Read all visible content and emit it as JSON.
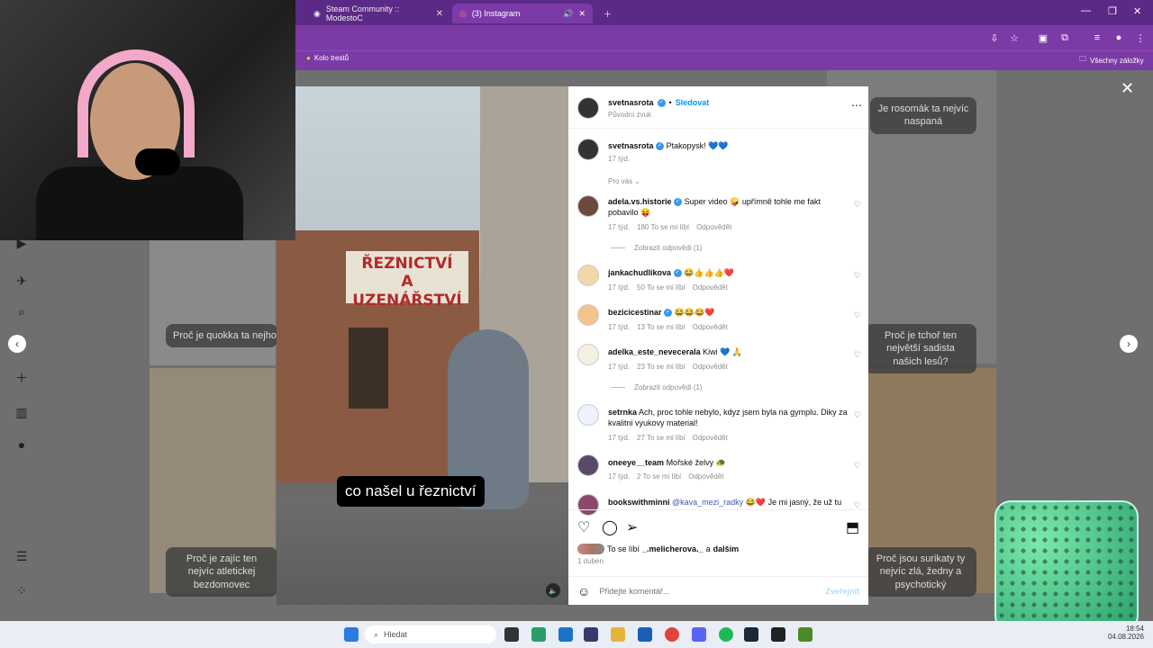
{
  "browser": {
    "tabs": [
      {
        "title": "Steam Community :: ModestoC",
        "active": false
      },
      {
        "title": "(3) Instagram",
        "active": true
      }
    ],
    "bookmarks": {
      "left_item": "Kolo trestů",
      "right_item": "Všechny záložky"
    }
  },
  "page": {
    "captions": {
      "top_right": "Je rosomák ta nejvíc naspaná",
      "left_mid": "Proč je quokka ta nejhorší psychopatická",
      "right_mid": "Proč je tchoř ten největší sadista našich lesů?",
      "left_bottom": "Proč je zajíc ten nejvíc atletickej bezdomovec",
      "right_bottom": "Proč jsou surikaty ty nejvíc zlá, žedny a psychotický"
    }
  },
  "video": {
    "subtitle": "co našel u řeznictví",
    "sign_line1": "ŘEZNICTVÍ",
    "sign_line2": "A UZENÁŘSTVÍ"
  },
  "post": {
    "author": "svetnasrota",
    "follow_label": "Sledovat",
    "audio": "Původní zvuk",
    "caption_text": "Ptakopysk! 💙💙",
    "caption_time": "17 týd.",
    "for_you": "Pro vás",
    "comments": [
      {
        "user": "adela.vs.historie",
        "verified": true,
        "text": "Super video 🤪 upřímně tohle me fakt pobavilo 😝",
        "time": "17 týd.",
        "likes": "180 To se mi líbí",
        "reply": "Odpovědět",
        "replies": "Zobrazit odpovědi (1)"
      },
      {
        "user": "jankachudlikova",
        "verified": true,
        "text": "😂👍👍👍❤️",
        "time": "17 týd.",
        "likes": "50 To se mi líbí",
        "reply": "Odpovědět"
      },
      {
        "user": "bezicicestinar",
        "verified": true,
        "text": "😂😂😂❤️",
        "time": "17 týd.",
        "likes": "13 To se mi líbí",
        "reply": "Odpovědět"
      },
      {
        "user": "adelka_este_nevecerala",
        "verified": false,
        "text": "Kiwi 💙 🙏",
        "time": "17 týd.",
        "likes": "23 To se mi líbí",
        "reply": "Odpovědět",
        "replies": "Zobrazit odpovědi (1)"
      },
      {
        "user": "setrnka",
        "verified": false,
        "text": "Ach, proc tohle nebylo, kdyz jsem byla na gymplu. Diky za kvalitni vyukovy material!",
        "time": "17 týd.",
        "likes": "27 To se mi líbí",
        "reply": "Odpovědět"
      },
      {
        "user": "oneeye__team",
        "verified": false,
        "text": "Mořské želvy 🐢",
        "time": "17 týd.",
        "likes": "2 To se mi líbí",
        "reply": "Odpovědět"
      },
      {
        "user": "bookswithminni",
        "verified": false,
        "mention": "@kava_mezi_radky",
        "text": "😂❤️ Je mi jasný, že už tu"
      }
    ],
    "likes_line_prefix": "To se líbí",
    "likes_user": "_.melicherova._",
    "likes_line_join": "a",
    "likes_others": "dalším",
    "date": "1 duben",
    "comment_placeholder": "Přidejte komentář...",
    "publish_label": "Zveřejnit"
  },
  "taskbar": {
    "search_placeholder": "Hledat",
    "time": "18:54",
    "date": "04.08.2026"
  },
  "colors": {
    "browser_purple": "#7b3aa6",
    "instagram_blue": "#3897f0"
  }
}
